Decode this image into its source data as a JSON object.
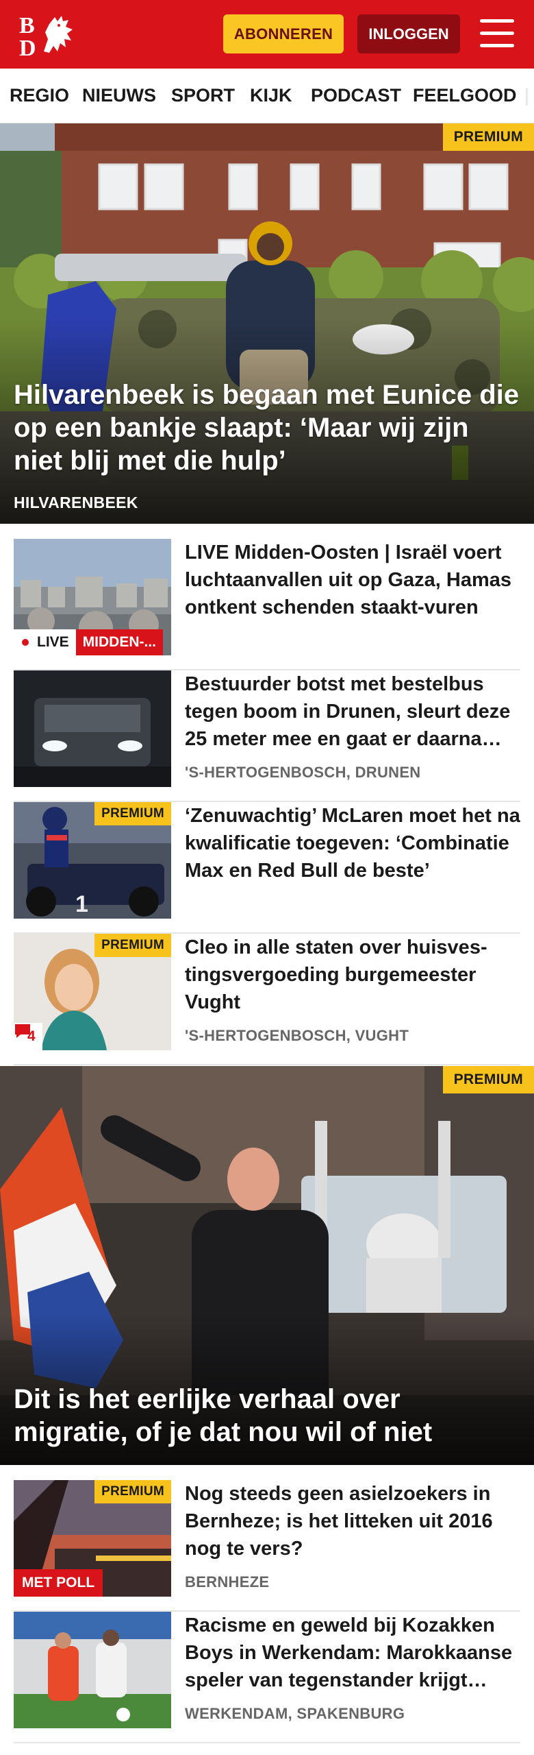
{
  "header": {
    "logo_text": "BD",
    "subscribe_label": "ABONNEREN",
    "login_label": "INLOGGEN",
    "menu_icon": "hamburger-menu-icon",
    "brand_color": "#d9131a",
    "subscribe_color": "#f9c623"
  },
  "nav": {
    "items": [
      "REGIO",
      "NIEUWS",
      "SPORT",
      "KIJK",
      "PODCAST",
      "FEELGOOD"
    ]
  },
  "hero1": {
    "badge": "PREMIUM",
    "title": "Hilvarenbeek is begaan met Eunice die op een bankje slaapt: ‘Maar wij zijn niet blij met die hulp’",
    "location": "HILVARENBEEK"
  },
  "articles": [
    {
      "title": "LIVE Midden-Oosten | Israël voert luchtaanvallen uit op Gaza, Hamas ontkent schenden staakt-vuren",
      "live_label": "LIVE",
      "tag": "MIDDEN-..."
    },
    {
      "title": "Bestuurder botst met bestelbus tegen boom in Drunen, sleurt deze 25 meter mee en gaat er daarna vandoor",
      "location": "'S-HERTOGENBOSCH, DRUNEN"
    },
    {
      "title": "‘Zenuwachtig’ McLaren moet het na kwalificatie toegeven: ‘Combinatie Max en Red Bull de beste’",
      "badge": "PREMIUM"
    },
    {
      "title": "Cleo in alle staten over huisves­tingsvergoeding burgemeester Vught",
      "badge": "PREMIUM",
      "location": "'S-HERTOGENBOSCH, VUGHT",
      "comments": "4"
    }
  ],
  "hero2": {
    "badge": "PREMIUM",
    "title": "Dit is het eerlijke verhaal over migratie, of je dat nou wil of niet"
  },
  "articles2": [
    {
      "title": "Nog steeds geen asielzoekers in Bernheze; is het litteken uit 2016 nog te vers?",
      "badge": "PREMIUM",
      "location": "BERNHEZE",
      "poll_label": "MET POLL"
    },
    {
      "title": "Racisme en geweld bij Kozakken Boys in Werkendam: Marokkaan­se speler van tegenstander krijgt klappen",
      "location": "WERKENDAM, SPAKENBURG"
    }
  ]
}
